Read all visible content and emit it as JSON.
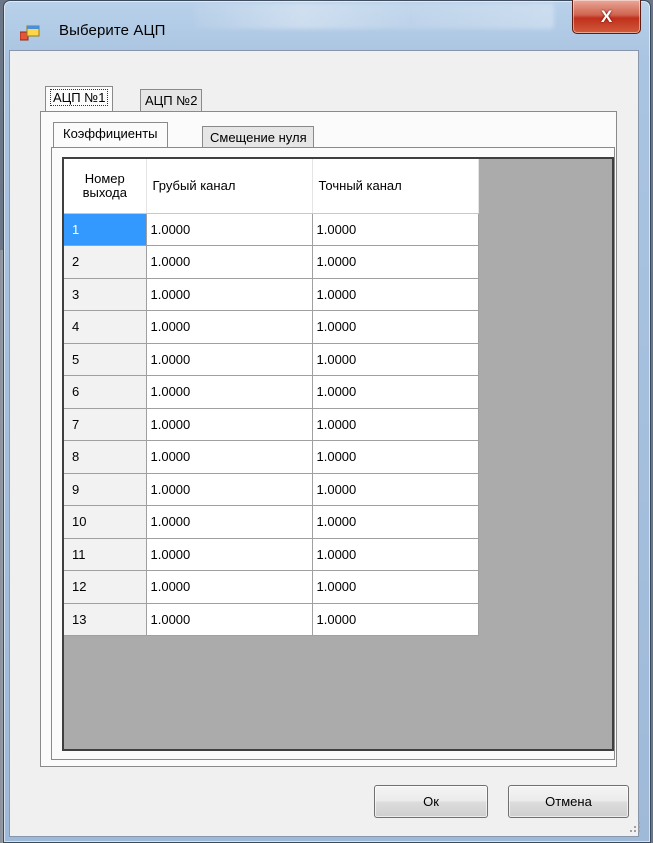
{
  "window": {
    "title": "Выберите АЦП",
    "close_label": "X"
  },
  "outer_tabs": [
    {
      "label": "АЦП №1",
      "active": true
    },
    {
      "label": "АЦП №2",
      "active": false
    }
  ],
  "inner_tabs": [
    {
      "label": "Коэффициенты",
      "active": true
    },
    {
      "label": "Смещение нуля",
      "active": false
    }
  ],
  "grid": {
    "columns": {
      "num_line1": "Номер",
      "num_line2": "выхода",
      "coarse": "Грубый канал",
      "fine": "Точный канал"
    },
    "rows": [
      {
        "num": "1",
        "coarse": "1.0000",
        "fine": "1.0000",
        "selected": true
      },
      {
        "num": "2",
        "coarse": "1.0000",
        "fine": "1.0000"
      },
      {
        "num": "3",
        "coarse": "1.0000",
        "fine": "1.0000"
      },
      {
        "num": "4",
        "coarse": "1.0000",
        "fine": "1.0000"
      },
      {
        "num": "5",
        "coarse": "1.0000",
        "fine": "1.0000"
      },
      {
        "num": "6",
        "coarse": "1.0000",
        "fine": "1.0000"
      },
      {
        "num": "7",
        "coarse": "1.0000",
        "fine": "1.0000"
      },
      {
        "num": "8",
        "coarse": "1.0000",
        "fine": "1.0000"
      },
      {
        "num": "9",
        "coarse": "1.0000",
        "fine": "1.0000"
      },
      {
        "num": "10",
        "coarse": "1.0000",
        "fine": "1.0000"
      },
      {
        "num": "11",
        "coarse": "1.0000",
        "fine": "1.0000"
      },
      {
        "num": "12",
        "coarse": "1.0000",
        "fine": "1.0000"
      },
      {
        "num": "13",
        "coarse": "1.0000",
        "fine": "1.0000"
      }
    ]
  },
  "buttons": {
    "ok": "Ок",
    "cancel": "Отмена"
  },
  "colors": {
    "selection": "#3399ff",
    "close_button": "#c0301c",
    "grid_empty_area": "#ababab"
  }
}
